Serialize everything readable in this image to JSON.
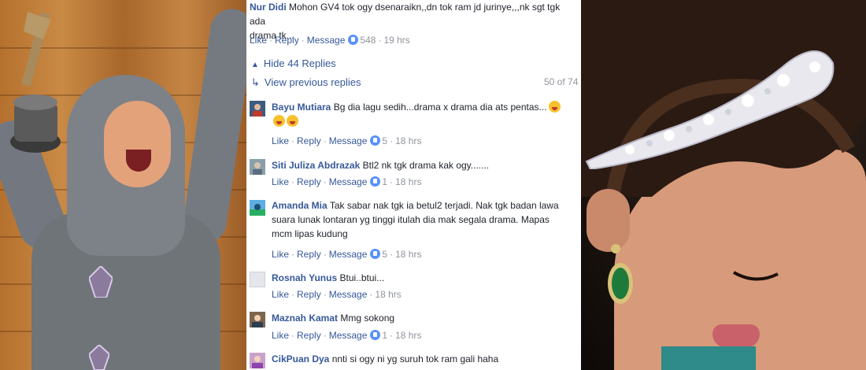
{
  "top_comment": {
    "author": "Nur Didi",
    "text_line1": "Mohon GV4 tok ogy dsenaraikn,,dn tok ram jd jurinye,,,nk sgt tgk ada",
    "text_line2": "drama tk...",
    "actions": {
      "like": "Like",
      "reply": "Reply",
      "message": "Message",
      "reactions": "548",
      "time": "19 hrs"
    }
  },
  "thread": {
    "hide_replies": "Hide 44 Replies",
    "view_previous": "View previous replies",
    "counter": "50 of 74"
  },
  "replies": [
    {
      "author": "Bayu Mutiara",
      "text_line1": "Bg dia lagu sedih...drama x drama dia ats pentas...",
      "text_line2": "",
      "actions": {
        "like": "Like",
        "reply": "Reply",
        "message": "Message",
        "reactions": "5",
        "time": "18 hrs"
      }
    },
    {
      "author": "Siti Juliza Abdrazak",
      "text_line1": "Btl2 nk tgk drama kak ogy.......",
      "text_line2": "",
      "actions": {
        "like": "Like",
        "reply": "Reply",
        "message": "Message",
        "reactions": "1",
        "time": "18 hrs"
      }
    },
    {
      "author": "Amanda Mia",
      "text_line1": "Tak sabar nak tgk ia betul2 terjadi. Nak tgk badan lawa",
      "text_line2": "suara lunak lontaran yg tinggi itulah dia mak segala drama. Mapas",
      "text_line3": "mcm lipas kudung",
      "actions": {
        "like": "Like",
        "reply": "Reply",
        "message": "Message",
        "reactions": "5",
        "time": "18 hrs"
      }
    },
    {
      "author": "Rosnah Yunus",
      "text_line1": "Btui..btui...",
      "text_line2": "",
      "actions": {
        "like": "Like",
        "reply": "Reply",
        "message": "Message",
        "reactions": "",
        "time": "18 hrs"
      }
    },
    {
      "author": "Maznah Kamat",
      "text_line1": "Mmg sokong",
      "text_line2": "",
      "actions": {
        "like": "Like",
        "reply": "Reply",
        "message": "Message",
        "reactions": "1",
        "time": "18 hrs"
      }
    },
    {
      "author": "CikPuan Dya",
      "text_line1": "nnti si ogy ni yg suruh tok ram gali haha",
      "text_line2": ""
    }
  ],
  "colors": {
    "link": "#365899",
    "meta": "#90949c",
    "like_blue": "#5890ff"
  },
  "icons": {
    "reply_arrow": "reply-arrow-icon",
    "collapse": "chevron-up-icon",
    "like": "like-icon"
  }
}
